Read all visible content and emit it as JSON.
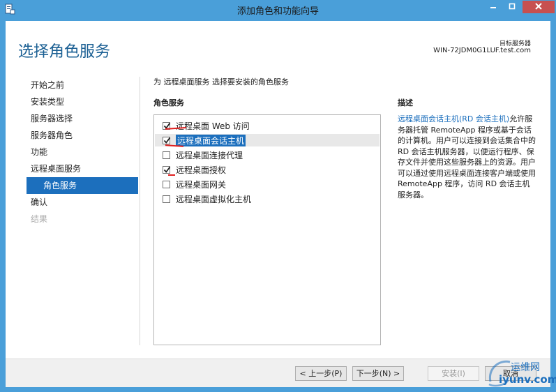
{
  "window": {
    "title": "添加角色和功能向导"
  },
  "page": {
    "heading": "选择角色服务",
    "destination_label": "目标服务器",
    "destination_server": "WIN-72JDM0G1LUF.test.com"
  },
  "nav": [
    {
      "label": "开始之前",
      "state": "normal"
    },
    {
      "label": "安装类型",
      "state": "normal"
    },
    {
      "label": "服务器选择",
      "state": "normal"
    },
    {
      "label": "服务器角色",
      "state": "normal"
    },
    {
      "label": "功能",
      "state": "normal"
    },
    {
      "label": "远程桌面服务",
      "state": "normal"
    },
    {
      "label": "角色服务",
      "state": "selected"
    },
    {
      "label": "确认",
      "state": "normal"
    },
    {
      "label": "结果",
      "state": "disabled"
    }
  ],
  "main": {
    "instruction": "为 远程桌面服务 选择要安装的角色服务",
    "section_label": "角色服务",
    "services": [
      {
        "label": "远程桌面 Web 访问",
        "checked": true
      },
      {
        "label": "远程桌面会话主机",
        "checked": true,
        "selected": true
      },
      {
        "label": "远程桌面连接代理",
        "checked": false
      },
      {
        "label": "远程桌面授权",
        "checked": true
      },
      {
        "label": "远程桌面网关",
        "checked": false
      },
      {
        "label": "远程桌面虚拟化主机",
        "checked": false
      }
    ]
  },
  "description": {
    "title": "描述",
    "link": "远程桌面会话主机(RD 会话主机)",
    "text": "允许服务器托管 RemoteApp 程序或基于会话的计算机。用户可以连接到会话集合中的 RD 会话主机服务器，以便运行程序、保存文件并使用这些服务器上的资源。用户可以通过使用远程桌面连接客户端或使用 RemoteApp 程序，访问 RD 会话主机服务器。"
  },
  "buttons": {
    "prev": "< 上一步(P)",
    "next": "下一步(N) >",
    "install": "安装(I)",
    "cancel": "取消"
  },
  "watermark": {
    "top": "运维网",
    "bottom": "iyunv.com"
  },
  "colors": {
    "accent": "#1c6fbd",
    "titlebar": "#4a9fd9",
    "close": "#c75050",
    "annotation": "#e02020"
  }
}
